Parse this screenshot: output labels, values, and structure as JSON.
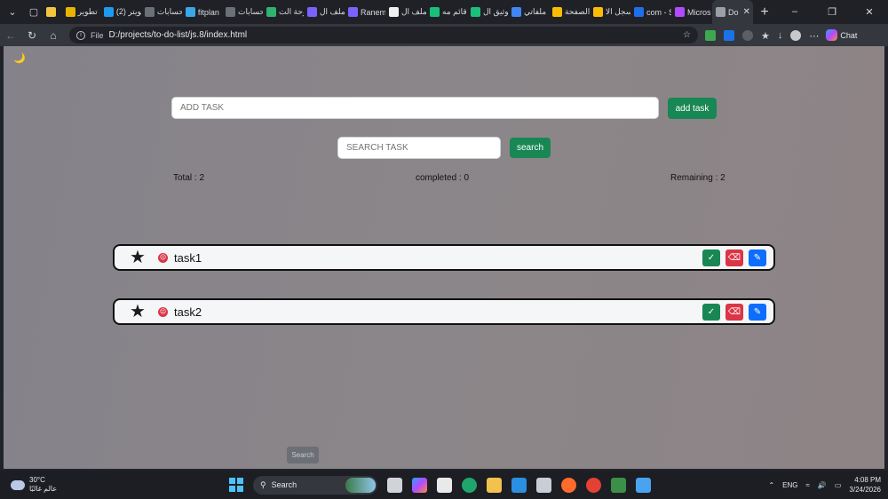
{
  "browser": {
    "tabs": [
      {
        "label": "",
        "color": "#f5c542"
      },
      {
        "label": "تطوير",
        "color": "#e9b400"
      },
      {
        "label": "(2) تويتر",
        "color": "#1d9bf0"
      },
      {
        "label": "حسابات",
        "color": "#6b6f76"
      },
      {
        "label": "fitplan",
        "color": "#3aa7e8"
      },
      {
        "label": "حسابات",
        "color": "#6b6f76"
      },
      {
        "label": "لوحة الت",
        "color": "#2fb36e"
      },
      {
        "label": "الملف ال",
        "color": "#7b61ff"
      },
      {
        "label": "Ranem",
        "color": "#7b61ff"
      },
      {
        "label": "الملف ال",
        "color": "#f0f0f0"
      },
      {
        "label": "قائم مه",
        "color": "#1bbf7a"
      },
      {
        "label": "توثيق ال",
        "color": "#1bbf7a"
      },
      {
        "label": "ملفاتي",
        "color": "#4285f4"
      },
      {
        "label": "الصفحة",
        "color": "#fbbc04"
      },
      {
        "label": "سجل الا",
        "color": "#fbbc04"
      },
      {
        "label": "com - S",
        "color": "#1f6feb"
      },
      {
        "label": "Micros",
        "color": "#b34aff"
      },
      {
        "label": "Do",
        "color": "#9aa0a6",
        "active": true
      }
    ],
    "url_label": "File",
    "url": "D:/projects/to-do-list/js.8/index.html",
    "chat_label": "Chat"
  },
  "app": {
    "theme_icon": "moon-icon",
    "add_placeholder": "ADD TASK",
    "add_button": "add task",
    "search_placeholder": "SEARCH TASK",
    "search_button": "search",
    "stats": {
      "total": "Total : 2",
      "completed": "completed : 0",
      "remaining": "Remaining : 2"
    },
    "tasks": [
      {
        "name": "task1"
      },
      {
        "name": "task2"
      }
    ],
    "bottom_search": "Search",
    "colors": {
      "success": "#198754",
      "danger": "#dc3545",
      "primary": "#0d6efd"
    }
  },
  "taskbar": {
    "temp": "30°C",
    "weather_text": "عالم غالبًا",
    "search_label": "Search",
    "lang": "ENG",
    "time": "4:08 PM",
    "date": "3/24/2026"
  }
}
